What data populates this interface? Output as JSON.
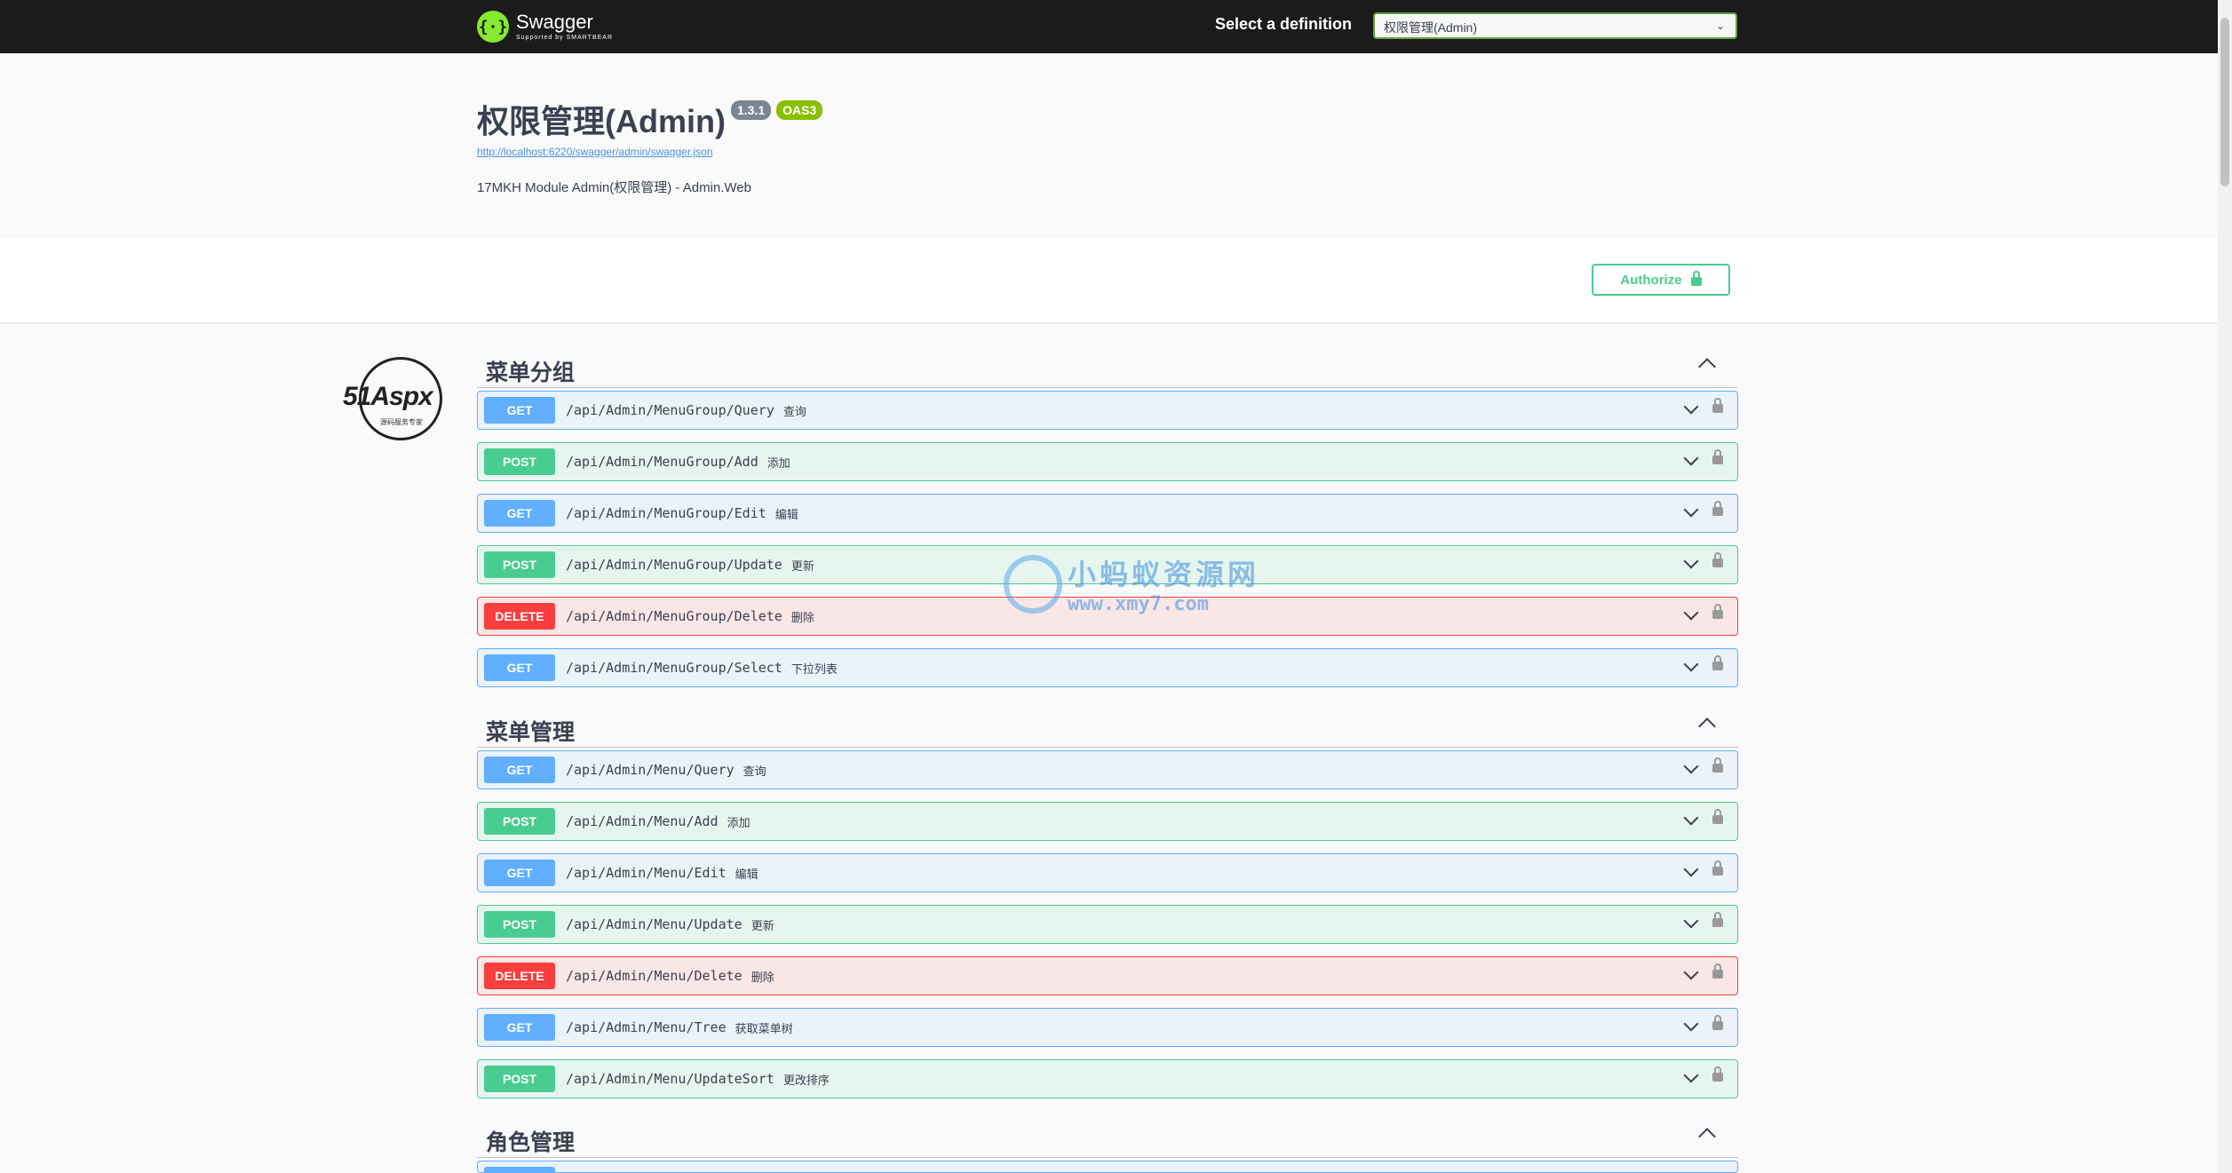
{
  "topbar": {
    "logo_name": "Swagger",
    "logo_sub": "Supported by SMARTBEAR",
    "definition_label": "Select a definition",
    "definition_value": "权限管理(Admin)"
  },
  "info": {
    "title": "权限管理(Admin)",
    "version": "1.3.1",
    "oas": "OAS3",
    "spec_url": "http://localhost:6220/swagger/admin/swagger.json",
    "description": "17MKH Module Admin(权限管理) - Admin.Web"
  },
  "auth": {
    "label": "Authorize"
  },
  "side_logo": {
    "text": "51Aspx",
    "sub": "源码服务专家"
  },
  "watermark": {
    "cn": "小蚂蚁资源网",
    "en": "www.xmy7.com"
  },
  "sections": [
    {
      "name": "菜单分组",
      "ops": [
        {
          "method": "GET",
          "path": "/api/Admin/MenuGroup/Query",
          "summary": "查询"
        },
        {
          "method": "POST",
          "path": "/api/Admin/MenuGroup/Add",
          "summary": "添加"
        },
        {
          "method": "GET",
          "path": "/api/Admin/MenuGroup/Edit",
          "summary": "编辑"
        },
        {
          "method": "POST",
          "path": "/api/Admin/MenuGroup/Update",
          "summary": "更新"
        },
        {
          "method": "DELETE",
          "path": "/api/Admin/MenuGroup/Delete",
          "summary": "删除"
        },
        {
          "method": "GET",
          "path": "/api/Admin/MenuGroup/Select",
          "summary": "下拉列表"
        }
      ]
    },
    {
      "name": "菜单管理",
      "ops": [
        {
          "method": "GET",
          "path": "/api/Admin/Menu/Query",
          "summary": "查询"
        },
        {
          "method": "POST",
          "path": "/api/Admin/Menu/Add",
          "summary": "添加"
        },
        {
          "method": "GET",
          "path": "/api/Admin/Menu/Edit",
          "summary": "编辑"
        },
        {
          "method": "POST",
          "path": "/api/Admin/Menu/Update",
          "summary": "更新"
        },
        {
          "method": "DELETE",
          "path": "/api/Admin/Menu/Delete",
          "summary": "删除"
        },
        {
          "method": "GET",
          "path": "/api/Admin/Menu/Tree",
          "summary": "获取菜单树"
        },
        {
          "method": "POST",
          "path": "/api/Admin/Menu/UpdateSort",
          "summary": "更改排序"
        }
      ]
    },
    {
      "name": "角色管理",
      "ops": []
    }
  ]
}
